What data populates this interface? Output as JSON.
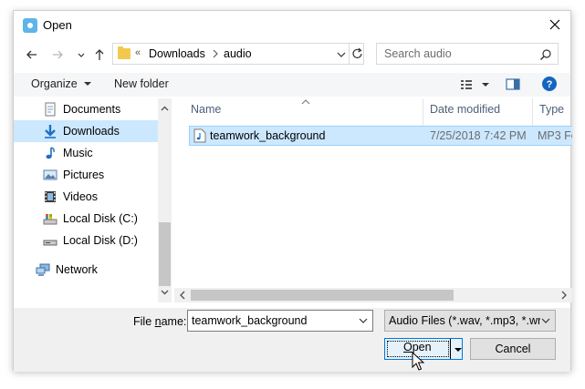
{
  "window": {
    "title": "Open",
    "close_icon": "close-icon"
  },
  "navigation": {
    "breadcrumb_prefix": "«",
    "path": [
      "Downloads",
      "audio"
    ],
    "search_placeholder": "Search audio"
  },
  "toolbar": {
    "organize_label": "Organize",
    "new_folder_label": "New folder"
  },
  "sidebar": {
    "items": [
      {
        "label": "Documents",
        "icon": "documents-icon"
      },
      {
        "label": "Downloads",
        "icon": "downloads-icon",
        "selected": true
      },
      {
        "label": "Music",
        "icon": "music-icon"
      },
      {
        "label": "Pictures",
        "icon": "pictures-icon"
      },
      {
        "label": "Videos",
        "icon": "videos-icon"
      },
      {
        "label": "Local Disk (C:)",
        "icon": "drive-icon"
      },
      {
        "label": "Local Disk (D:)",
        "icon": "drive-icon"
      },
      {
        "label": "Network",
        "icon": "network-icon"
      }
    ]
  },
  "file_list": {
    "columns": [
      "Name",
      "Date modified",
      "Type"
    ],
    "rows": [
      {
        "name": "teamwork_background",
        "date_modified": "7/25/2018 7:42 PM",
        "type": "MP3 Fo"
      }
    ]
  },
  "bottom": {
    "file_name_label_pre": "File ",
    "file_name_label_accel": "n",
    "file_name_label_post": "ame:",
    "file_name_value": "teamwork_background",
    "filter_value": "Audio Files (*.wav, *.mp3, *.wm",
    "open_label_accel": "O",
    "open_label_rest": "pen",
    "cancel_label": "Cancel"
  },
  "colors": {
    "selection": "#cce8ff",
    "accent": "#0078d7",
    "help": "#1565c0"
  }
}
